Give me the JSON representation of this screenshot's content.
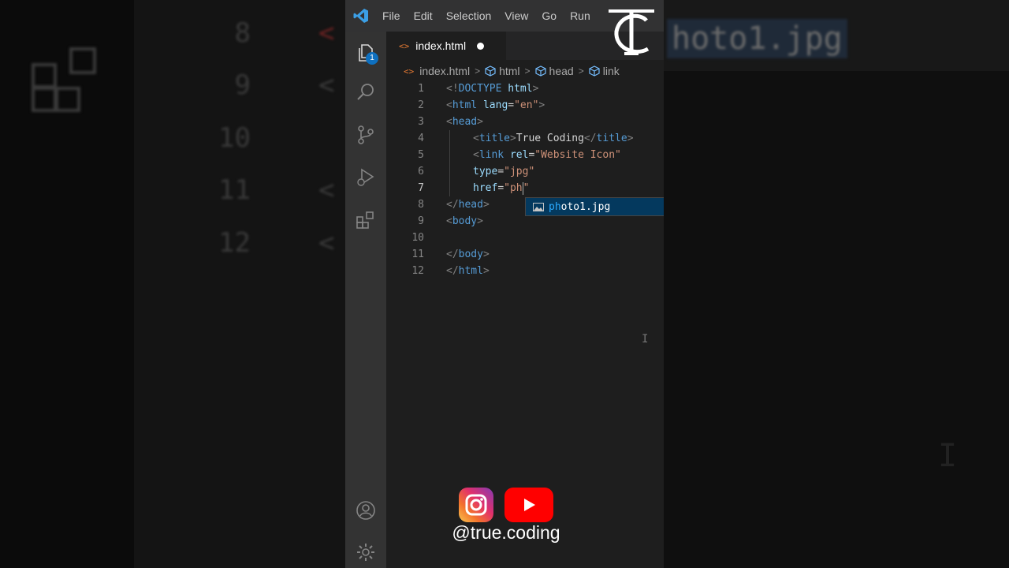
{
  "menu": [
    "File",
    "Edit",
    "Selection",
    "View",
    "Go",
    "Run"
  ],
  "activity_badge": "1",
  "tab": {
    "label": "index.html",
    "icon": "html-file-icon",
    "modified": true
  },
  "breadcrumb": {
    "file": "index.html",
    "html": "html",
    "head": "head",
    "link": "link"
  },
  "code_lines": [
    {
      "n": "1",
      "parts": [
        [
          "t-tag",
          "<!"
        ],
        [
          "t-name",
          "DOCTYPE"
        ],
        [
          "t-text",
          " "
        ],
        [
          "t-attr",
          "html"
        ],
        [
          "t-tag",
          ">"
        ]
      ]
    },
    {
      "n": "2",
      "parts": [
        [
          "t-tag",
          "<"
        ],
        [
          "t-name",
          "html"
        ],
        [
          "t-text",
          " "
        ],
        [
          "t-attr",
          "lang"
        ],
        [
          "t-text",
          "="
        ],
        [
          "t-str",
          "\"en\""
        ],
        [
          "t-tag",
          ">"
        ]
      ]
    },
    {
      "n": "3",
      "parts": [
        [
          "t-tag",
          "<"
        ],
        [
          "t-name",
          "head"
        ],
        [
          "t-tag",
          ">"
        ]
      ]
    },
    {
      "n": "4",
      "indent": true,
      "parts": [
        [
          "t-tag",
          "<"
        ],
        [
          "t-name",
          "title"
        ],
        [
          "t-tag",
          ">"
        ],
        [
          "t-text",
          "True Coding"
        ],
        [
          "t-tag",
          "</"
        ],
        [
          "t-name",
          "title"
        ],
        [
          "t-tag",
          ">"
        ]
      ]
    },
    {
      "n": "5",
      "indent": true,
      "parts": [
        [
          "t-tag",
          "<"
        ],
        [
          "t-name",
          "link"
        ],
        [
          "t-text",
          " "
        ],
        [
          "t-attr",
          "rel"
        ],
        [
          "t-text",
          "="
        ],
        [
          "t-str",
          "\"Website Icon\""
        ]
      ]
    },
    {
      "n": "6",
      "indent": true,
      "parts": [
        [
          "t-attr",
          "type"
        ],
        [
          "t-text",
          "="
        ],
        [
          "t-str",
          "\"jpg\""
        ]
      ]
    },
    {
      "n": "7",
      "indent": true,
      "active": true,
      "parts": [
        [
          "t-attr",
          "href"
        ],
        [
          "t-text",
          "="
        ],
        [
          "t-str",
          "\"ph"
        ],
        [
          "cursor",
          ""
        ],
        [
          "t-str",
          "\""
        ]
      ]
    },
    {
      "n": "8",
      "parts": [
        [
          "t-tag",
          "</"
        ],
        [
          "t-name",
          "head"
        ],
        [
          "t-tag",
          ">"
        ]
      ]
    },
    {
      "n": "9",
      "parts": [
        [
          "t-tag",
          "<"
        ],
        [
          "t-name",
          "body"
        ],
        [
          "t-tag",
          ">"
        ]
      ]
    },
    {
      "n": "10",
      "parts": []
    },
    {
      "n": "11",
      "parts": [
        [
          "t-tag",
          "</"
        ],
        [
          "t-name",
          "body"
        ],
        [
          "t-tag",
          ">"
        ]
      ]
    },
    {
      "n": "12",
      "parts": [
        [
          "t-tag",
          "</"
        ],
        [
          "t-name",
          "html"
        ],
        [
          "t-tag",
          ">"
        ]
      ]
    }
  ],
  "suggestion": {
    "match": "ph",
    "rest": "oto1.jpg",
    "icon": "image-file-icon"
  },
  "social": {
    "handle": "@true.coding",
    "icons": [
      "instagram-icon",
      "youtube-icon"
    ]
  },
  "background": {
    "left_numbers": [
      "8",
      "9",
      "10",
      "11",
      "12"
    ],
    "right_text": "hoto1.jpg"
  },
  "colors": {
    "tag_name": "#569cd6",
    "attribute": "#9cdcfe",
    "string": "#ce9178",
    "bracket": "#808080",
    "selection": "#04395e",
    "badge": "#0e70c0"
  }
}
